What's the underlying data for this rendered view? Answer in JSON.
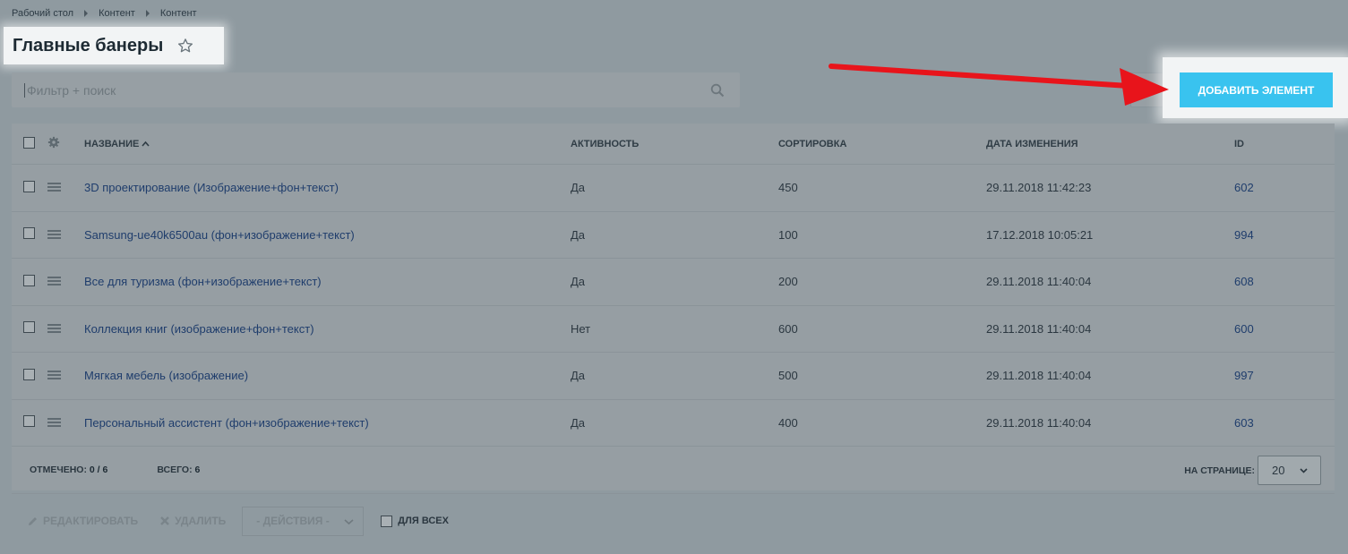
{
  "breadcrumb": [
    "Рабочий стол",
    "Контент",
    "Контент"
  ],
  "title": "Главные банеры",
  "filter": {
    "placeholder": "Фильтр + поиск"
  },
  "add_button": "ДОБАВИТЬ ЭЛЕМЕНТ",
  "columns": {
    "name": "НАЗВАНИЕ",
    "active": "АКТИВНОСТЬ",
    "sort": "СОРТИРОВКА",
    "date": "ДАТА ИЗМЕНЕНИЯ",
    "id": "ID"
  },
  "rows": [
    {
      "name": "3D проектирование (Изображение+фон+текст)",
      "active": "Да",
      "sort": "450",
      "date": "29.11.2018 11:42:23",
      "id": "602"
    },
    {
      "name": "Samsung-ue40k6500au (фон+изображение+текст)",
      "active": "Да",
      "sort": "100",
      "date": "17.12.2018 10:05:21",
      "id": "994"
    },
    {
      "name": "Все для туризма (фон+изображение+текст)",
      "active": "Да",
      "sort": "200",
      "date": "29.11.2018 11:40:04",
      "id": "608"
    },
    {
      "name": "Коллекция книг (изображение+фон+текст)",
      "active": "Нет",
      "sort": "600",
      "date": "29.11.2018 11:40:04",
      "id": "600"
    },
    {
      "name": "Мягкая мебель (изображение)",
      "active": "Да",
      "sort": "500",
      "date": "29.11.2018 11:40:04",
      "id": "997"
    },
    {
      "name": "Персональный ассистент (фон+изображение+текст)",
      "active": "Да",
      "sort": "400",
      "date": "29.11.2018 11:40:04",
      "id": "603"
    }
  ],
  "footer": {
    "selected_label": "ОТМЕЧЕНО:",
    "selected_value": "0 / 6",
    "total_label": "ВСЕГО:",
    "total_value": "6",
    "per_page_label": "НА СТРАНИЦЕ:",
    "per_page_value": "20"
  },
  "actions": {
    "edit": "РЕДАКТИРОВАТЬ",
    "delete": "УДАЛИТЬ",
    "actions_select": "- ДЕЙСТВИЯ -",
    "for_all": "ДЛЯ ВСЕХ"
  },
  "colors": {
    "accent": "#39c3ef",
    "arrow": "#e8141b",
    "link": "#1f3d6c"
  }
}
